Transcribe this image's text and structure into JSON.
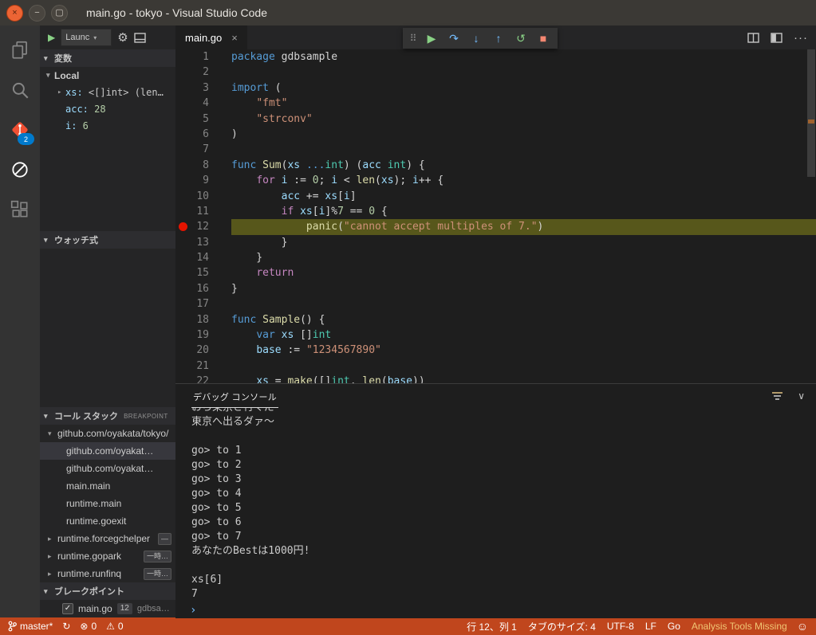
{
  "colors": {
    "status_bg": "#C0461D",
    "badge_blue": "#007ACC",
    "breakpoint": "#E51400",
    "stop_line": "#57571B",
    "debug_green": "#89D185",
    "debug_blue": "#75BEFF",
    "debug_red": "#F48771",
    "warning_text": "#F0C674",
    "selection": "#37373D",
    "git_orange": "#F05033"
  },
  "icons": {
    "win_close": "×",
    "win_min": "−",
    "win_max": "▢",
    "play": "▶",
    "gear": "⚙",
    "caret_down": "▾",
    "section_open": "▾",
    "row_closed": "▸",
    "grip": "⠿",
    "continue": "▶",
    "step_over": "↷",
    "step_into": "↓",
    "step_out": "↑",
    "restart": "↺",
    "stop": "■",
    "close": "×",
    "more": "···",
    "chevron_down": "∨",
    "check": "✓",
    "prompt": "›",
    "sync": "↻",
    "error": "⊗",
    "warning": "⚠",
    "smiley": "☺"
  },
  "window": {
    "title": "main.go - tokyo - Visual Studio Code"
  },
  "activity_bar": {
    "source_control_badge": "2"
  },
  "sidebar": {
    "toolbar": {
      "config": "Launc"
    },
    "variables": {
      "title": "変数",
      "scope": "Local",
      "items": [
        {
          "name": "xs",
          "value": "<[]int> (len…",
          "expandable": true
        },
        {
          "name": "acc",
          "value": "28",
          "num": true
        },
        {
          "name": "i",
          "value": "6",
          "num": true
        }
      ]
    },
    "watch": {
      "title": "ウォッチ式"
    },
    "call_stack": {
      "title": "コール スタック",
      "note": "BREAKPOINT …",
      "frames": [
        {
          "label": "github.com/oyakata/tokyo/",
          "thread": true,
          "expanded": true
        },
        {
          "label": "github.com/oyakat…",
          "selected": true,
          "child": true
        },
        {
          "label": "github.com/oyakat…",
          "child": true
        },
        {
          "label": "main.main",
          "child": true
        },
        {
          "label": "runtime.main",
          "child": true
        },
        {
          "label": "runtime.goexit",
          "child": true
        },
        {
          "label": "runtime.forcegchelper",
          "thread": true,
          "badge": "—"
        },
        {
          "label": "runtime.gopark",
          "thread": true,
          "badge": "一時…"
        },
        {
          "label": "runtime.runfinq",
          "thread": true,
          "badge": "一時…"
        }
      ]
    },
    "breakpoints": {
      "title": "ブレークポイント",
      "item": {
        "file": "main.go",
        "line": "12",
        "path": "gdbsa…"
      }
    }
  },
  "editor": {
    "tab": "main.go",
    "lines": [
      {
        "n": "1",
        "s": [
          [
            "kw",
            "package"
          ],
          [
            "pl",
            " gdbsample"
          ]
        ]
      },
      {
        "n": "2",
        "s": []
      },
      {
        "n": "3",
        "s": [
          [
            "kw",
            "import"
          ],
          [
            "pl",
            " ("
          ]
        ]
      },
      {
        "n": "4",
        "s": [
          [
            "pl",
            "    "
          ],
          [
            "st",
            "\"fmt\""
          ]
        ]
      },
      {
        "n": "5",
        "s": [
          [
            "pl",
            "    "
          ],
          [
            "st",
            "\"strconv\""
          ]
        ]
      },
      {
        "n": "6",
        "s": [
          [
            "pl",
            ")"
          ]
        ]
      },
      {
        "n": "7",
        "s": []
      },
      {
        "n": "8",
        "s": [
          [
            "kw",
            "func"
          ],
          [
            "pl",
            " "
          ],
          [
            "fn",
            "Sum"
          ],
          [
            "pl",
            "("
          ],
          [
            "vr",
            "xs"
          ],
          [
            "pl",
            " "
          ],
          [
            "kw",
            "..."
          ],
          [
            "ty",
            "int"
          ],
          [
            "pl",
            ") ("
          ],
          [
            "vr",
            "acc"
          ],
          [
            "pl",
            " "
          ],
          [
            "ty",
            "int"
          ],
          [
            "pl",
            ") {"
          ]
        ]
      },
      {
        "n": "9",
        "s": [
          [
            "pl",
            "    "
          ],
          [
            "ct",
            "for"
          ],
          [
            "pl",
            " "
          ],
          [
            "vr",
            "i"
          ],
          [
            "pl",
            " := "
          ],
          [
            "nu",
            "0"
          ],
          [
            "pl",
            "; "
          ],
          [
            "vr",
            "i"
          ],
          [
            "pl",
            " < "
          ],
          [
            "fn",
            "len"
          ],
          [
            "pl",
            "("
          ],
          [
            "vr",
            "xs"
          ],
          [
            "pl",
            "); "
          ],
          [
            "vr",
            "i"
          ],
          [
            "pl",
            "++ {"
          ]
        ]
      },
      {
        "n": "10",
        "s": [
          [
            "pl",
            "        "
          ],
          [
            "vr",
            "acc"
          ],
          [
            "pl",
            " += "
          ],
          [
            "vr",
            "xs"
          ],
          [
            "pl",
            "["
          ],
          [
            "vr",
            "i"
          ],
          [
            "pl",
            "]"
          ]
        ]
      },
      {
        "n": "11",
        "s": [
          [
            "pl",
            "        "
          ],
          [
            "ct",
            "if"
          ],
          [
            "pl",
            " "
          ],
          [
            "vr",
            "xs"
          ],
          [
            "pl",
            "["
          ],
          [
            "vr",
            "i"
          ],
          [
            "pl",
            "]%"
          ],
          [
            "nu",
            "7"
          ],
          [
            "pl",
            " == "
          ],
          [
            "nu",
            "0"
          ],
          [
            "pl",
            " {"
          ]
        ]
      },
      {
        "n": "12",
        "bp": true,
        "hl": true,
        "s": [
          [
            "pl",
            "            "
          ],
          [
            "fn",
            "panic"
          ],
          [
            "pl",
            "("
          ],
          [
            "st",
            "\"cannot accept multiples of 7.\""
          ],
          [
            "pl",
            ")"
          ]
        ]
      },
      {
        "n": "13",
        "s": [
          [
            "pl",
            "        }"
          ]
        ]
      },
      {
        "n": "14",
        "s": [
          [
            "pl",
            "    }"
          ]
        ]
      },
      {
        "n": "15",
        "s": [
          [
            "pl",
            "    "
          ],
          [
            "ct",
            "return"
          ]
        ]
      },
      {
        "n": "16",
        "s": [
          [
            "pl",
            "}"
          ]
        ]
      },
      {
        "n": "17",
        "s": []
      },
      {
        "n": "18",
        "s": [
          [
            "kw",
            "func"
          ],
          [
            "pl",
            " "
          ],
          [
            "fn",
            "Sample"
          ],
          [
            "pl",
            "() {"
          ]
        ]
      },
      {
        "n": "19",
        "s": [
          [
            "pl",
            "    "
          ],
          [
            "kw",
            "var"
          ],
          [
            "pl",
            " "
          ],
          [
            "vr",
            "xs"
          ],
          [
            "pl",
            " []"
          ],
          [
            "ty",
            "int"
          ]
        ]
      },
      {
        "n": "20",
        "s": [
          [
            "pl",
            "    "
          ],
          [
            "vr",
            "base"
          ],
          [
            "pl",
            " := "
          ],
          [
            "st",
            "\"1234567890\""
          ]
        ]
      },
      {
        "n": "21",
        "s": []
      },
      {
        "n": "22",
        "s": [
          [
            "pl",
            "    "
          ],
          [
            "vr",
            "xs"
          ],
          [
            "pl",
            " = "
          ],
          [
            "fn",
            "make"
          ],
          [
            "pl",
            "([]"
          ],
          [
            "ty",
            "int"
          ],
          [
            "pl",
            ", "
          ],
          [
            "fn",
            "len"
          ],
          [
            "pl",
            "("
          ],
          [
            "vr",
            "base"
          ],
          [
            "pl",
            "))"
          ]
        ]
      }
    ]
  },
  "panel": {
    "title": "デバッグ コンソール",
    "lines": [
      "おら東京さ行ぐだ〜",
      "東京へ出るダァ〜",
      "",
      "go> to 1",
      "go> to 2",
      "go> to 3",
      "go> to 4",
      "go> to 5",
      "go> to 6",
      "go> to 7",
      "あなたのBestは1000円!",
      "",
      "xs[6]",
      "7"
    ]
  },
  "status_bar": {
    "branch": "master*",
    "errors": "0",
    "warnings": "0",
    "right": [
      {
        "label": "行 12、列 1"
      },
      {
        "label": "タブのサイズ: 4"
      },
      {
        "label": "UTF-8"
      },
      {
        "label": "LF"
      },
      {
        "label": "Go"
      },
      {
        "label": "Analysis Tools Missing",
        "warn": true
      }
    ]
  }
}
